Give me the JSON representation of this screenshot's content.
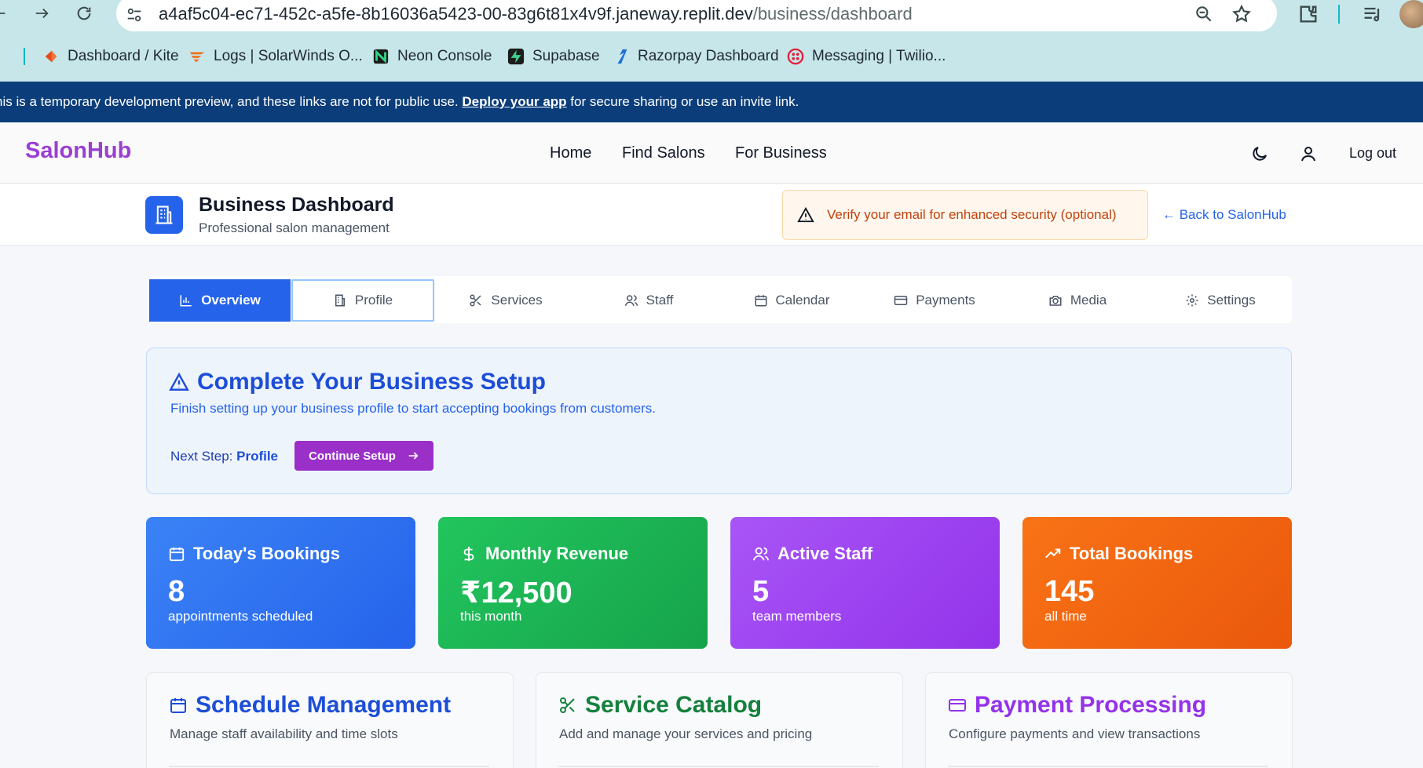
{
  "browser": {
    "url_host": "a4af5c04-ec71-452c-a5fe-8b16036a5423-00-83g6t81x4v9f.janeway.replit.dev",
    "url_path": "/business/dashboard",
    "bookmarks": [
      {
        "label": "Dashboard / Kite",
        "color": "#e84b1c"
      },
      {
        "label": "Logs | SolarWinds O...",
        "color": "#f2711c"
      },
      {
        "label": "Neon Console",
        "color": "#2fd98c"
      },
      {
        "label": "Supabase",
        "color": "#3ecf8e"
      },
      {
        "label": "Razorpay Dashboard",
        "color": "#1e6fd9"
      },
      {
        "label": "Messaging | Twilio...",
        "color": "#e31e3c"
      }
    ]
  },
  "dev_banner": {
    "before": "his is a temporary development preview, and these links are not for public use. ",
    "link": "Deploy your app",
    "after": " for secure sharing or use an invite link."
  },
  "header": {
    "brand": "SalonHub",
    "nav": [
      "Home",
      "Find Salons",
      "For Business"
    ],
    "logout": "Log out"
  },
  "subheader": {
    "title": "Business Dashboard",
    "subtitle": "Professional salon management",
    "verify": "Verify your email for enhanced security (optional)",
    "back": "← Back to SalonHub"
  },
  "tabs": [
    "Overview",
    "Profile",
    "Services",
    "Staff",
    "Calendar",
    "Payments",
    "Media",
    "Settings"
  ],
  "setup": {
    "title": "Complete Your Business Setup",
    "desc": "Finish setting up your business profile to start accepting bookings from customers.",
    "next_label": "Next Step:",
    "next_value": "Profile",
    "button": "Continue Setup"
  },
  "stats": [
    {
      "title": "Today's Bookings",
      "value": "8",
      "sub": "appointments scheduled"
    },
    {
      "title": "Monthly Revenue",
      "value": "₹12,500",
      "sub": "this month"
    },
    {
      "title": "Active Staff",
      "value": "5",
      "sub": "team members"
    },
    {
      "title": "Total Bookings",
      "value": "145",
      "sub": "all time"
    }
  ],
  "features": [
    {
      "title": "Schedule Management",
      "desc": "Manage staff availability and time slots",
      "color": "#1d4ed8"
    },
    {
      "title": "Service Catalog",
      "desc": "Add and manage your services and pricing",
      "color": "#15803d"
    },
    {
      "title": "Payment Processing",
      "desc": "Configure payments and view transactions",
      "color": "#9333ea"
    }
  ]
}
